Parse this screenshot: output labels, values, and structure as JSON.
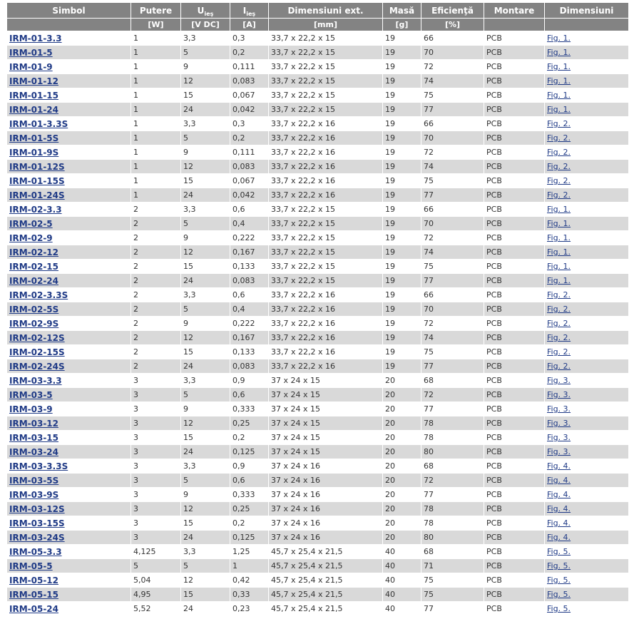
{
  "headers": {
    "simbol": "Simbol",
    "putere": "Putere",
    "u_main": "U",
    "u_sub": "ieş",
    "i_main": "I",
    "i_sub": "ieş",
    "dims": "Dimensiuni ext.",
    "masa": "Masă",
    "eficienta": "Eficienţă",
    "montare": "Montare",
    "dimensiuni": "Dimensiuni"
  },
  "units": {
    "simbol": "",
    "putere": "[W]",
    "u": "[V DC]",
    "i": "[A]",
    "dims": "[mm]",
    "masa": "[g]",
    "eficienta": "[%]",
    "montare": "",
    "dimensiuni": ""
  },
  "rows": [
    [
      "IRM-01-3.3",
      "1",
      "3,3",
      "0,3",
      "33,7 x 22,2 x 15",
      "19",
      "66",
      "PCB",
      "Fig. 1."
    ],
    [
      "IRM-01-5",
      "1",
      "5",
      "0,2",
      "33,7 x 22,2 x 15",
      "19",
      "70",
      "PCB",
      "Fig. 1."
    ],
    [
      "IRM-01-9",
      "1",
      "9",
      "0,111",
      "33,7 x 22,2 x 15",
      "19",
      "72",
      "PCB",
      "Fig. 1."
    ],
    [
      "IRM-01-12",
      "1",
      "12",
      "0,083",
      "33,7 x 22,2 x 15",
      "19",
      "74",
      "PCB",
      "Fig. 1."
    ],
    [
      "IRM-01-15",
      "1",
      "15",
      "0,067",
      "33,7 x 22,2 x 15",
      "19",
      "75",
      "PCB",
      "Fig. 1."
    ],
    [
      "IRM-01-24",
      "1",
      "24",
      "0,042",
      "33,7 x 22,2 x 15",
      "19",
      "77",
      "PCB",
      "Fig. 1."
    ],
    [
      "IRM-01-3.3S",
      "1",
      "3,3",
      "0,3",
      "33,7 x 22,2 x 16",
      "19",
      "66",
      "PCB",
      "Fig. 2."
    ],
    [
      "IRM-01-5S",
      "1",
      "5",
      "0,2",
      "33,7 x 22,2 x 16",
      "19",
      "70",
      "PCB",
      "Fig. 2."
    ],
    [
      "IRM-01-9S",
      "1",
      "9",
      "0,111",
      "33,7 x 22,2 x 16",
      "19",
      "72",
      "PCB",
      "Fig. 2."
    ],
    [
      "IRM-01-12S",
      "1",
      "12",
      "0,083",
      "33,7 x 22,2 x 16",
      "19",
      "74",
      "PCB",
      "Fig. 2."
    ],
    [
      "IRM-01-15S",
      "1",
      "15",
      "0,067",
      "33,7 x 22,2 x 16",
      "19",
      "75",
      "PCB",
      "Fig. 2."
    ],
    [
      "IRM-01-24S",
      "1",
      "24",
      "0,042",
      "33,7 x 22,2 x 16",
      "19",
      "77",
      "PCB",
      "Fig. 2."
    ],
    [
      "IRM-02-3.3",
      "2",
      "3,3",
      "0,6",
      "33,7 x 22,2 x 15",
      "19",
      "66",
      "PCB",
      "Fig. 1."
    ],
    [
      "IRM-02-5",
      "2",
      "5",
      "0,4",
      "33,7 x 22,2 x 15",
      "19",
      "70",
      "PCB",
      "Fig. 1."
    ],
    [
      "IRM-02-9",
      "2",
      "9",
      "0,222",
      "33,7 x 22,2 x 15",
      "19",
      "72",
      "PCB",
      "Fig. 1."
    ],
    [
      "IRM-02-12",
      "2",
      "12",
      "0,167",
      "33,7 x 22,2 x 15",
      "19",
      "74",
      "PCB",
      "Fig. 1."
    ],
    [
      "IRM-02-15",
      "2",
      "15",
      "0,133",
      "33,7 x 22,2 x 15",
      "19",
      "75",
      "PCB",
      "Fig. 1."
    ],
    [
      "IRM-02-24",
      "2",
      "24",
      "0,083",
      "33,7 x 22,2 x 15",
      "19",
      "77",
      "PCB",
      "Fig. 1."
    ],
    [
      "IRM-02-3.3S",
      "2",
      "3,3",
      "0,6",
      "33,7 x 22,2 x 16",
      "19",
      "66",
      "PCB",
      "Fig. 2."
    ],
    [
      "IRM-02-5S",
      "2",
      "5",
      "0,4",
      "33,7 x 22,2 x 16",
      "19",
      "70",
      "PCB",
      "Fig. 2."
    ],
    [
      "IRM-02-9S",
      "2",
      "9",
      "0,222",
      "33,7 x 22,2 x 16",
      "19",
      "72",
      "PCB",
      "Fig. 2."
    ],
    [
      "IRM-02-12S",
      "2",
      "12",
      "0,167",
      "33,7 x 22,2 x 16",
      "19",
      "74",
      "PCB",
      "Fig. 2."
    ],
    [
      "IRM-02-15S",
      "2",
      "15",
      "0,133",
      "33,7 x 22,2 x 16",
      "19",
      "75",
      "PCB",
      "Fig. 2."
    ],
    [
      "IRM-02-24S",
      "2",
      "24",
      "0,083",
      "33,7 x 22,2 x 16",
      "19",
      "77",
      "PCB",
      "Fig. 2."
    ],
    [
      "IRM-03-3.3",
      "3",
      "3,3",
      "0,9",
      "37 x 24 x 15",
      "20",
      "68",
      "PCB",
      "Fig. 3."
    ],
    [
      "IRM-03-5",
      "3",
      "5",
      "0,6",
      "37 x 24 x 15",
      "20",
      "72",
      "PCB",
      "Fig. 3."
    ],
    [
      "IRM-03-9",
      "3",
      "9",
      "0,333",
      "37 x 24 x 15",
      "20",
      "77",
      "PCB",
      "Fig. 3."
    ],
    [
      "IRM-03-12",
      "3",
      "12",
      "0,25",
      "37 x 24 x 15",
      "20",
      "78",
      "PCB",
      "Fig. 3."
    ],
    [
      "IRM-03-15",
      "3",
      "15",
      "0,2",
      "37 x 24 x 15",
      "20",
      "78",
      "PCB",
      "Fig. 3."
    ],
    [
      "IRM-03-24",
      "3",
      "24",
      "0,125",
      "37 x 24 x 15",
      "20",
      "80",
      "PCB",
      "Fig. 3."
    ],
    [
      "IRM-03-3.3S",
      "3",
      "3,3",
      "0,9",
      "37 x 24 x 16",
      "20",
      "68",
      "PCB",
      "Fig. 4."
    ],
    [
      "IRM-03-5S",
      "3",
      "5",
      "0,6",
      "37 x 24 x 16",
      "20",
      "72",
      "PCB",
      "Fig. 4."
    ],
    [
      "IRM-03-9S",
      "3",
      "9",
      "0,333",
      "37 x 24 x 16",
      "20",
      "77",
      "PCB",
      "Fig. 4."
    ],
    [
      "IRM-03-12S",
      "3",
      "12",
      "0,25",
      "37 x 24 x 16",
      "20",
      "78",
      "PCB",
      "Fig. 4."
    ],
    [
      "IRM-03-15S",
      "3",
      "15",
      "0,2",
      "37 x 24 x 16",
      "20",
      "78",
      "PCB",
      "Fig. 4."
    ],
    [
      "IRM-03-24S",
      "3",
      "24",
      "0,125",
      "37 x 24 x 16",
      "20",
      "80",
      "PCB",
      "Fig. 4."
    ],
    [
      "IRM-05-3.3",
      "4,125",
      "3,3",
      "1,25",
      "45,7 x 25,4 x 21,5",
      "40",
      "68",
      "PCB",
      "Fig. 5."
    ],
    [
      "IRM-05-5",
      "5",
      "5",
      "1",
      "45,7 x 25,4 x 21,5",
      "40",
      "71",
      "PCB",
      "Fig. 5."
    ],
    [
      "IRM-05-12",
      "5,04",
      "12",
      "0,42",
      "45,7 x 25,4 x 21,5",
      "40",
      "75",
      "PCB",
      "Fig. 5."
    ],
    [
      "IRM-05-15",
      "4,95",
      "15",
      "0,33",
      "45,7 x 25,4 x 21,5",
      "40",
      "75",
      "PCB",
      "Fig. 5."
    ],
    [
      "IRM-05-24",
      "5,52",
      "24",
      "0,23",
      "45,7 x 25,4 x 21,5",
      "40",
      "77",
      "PCB",
      "Fig. 5."
    ]
  ]
}
